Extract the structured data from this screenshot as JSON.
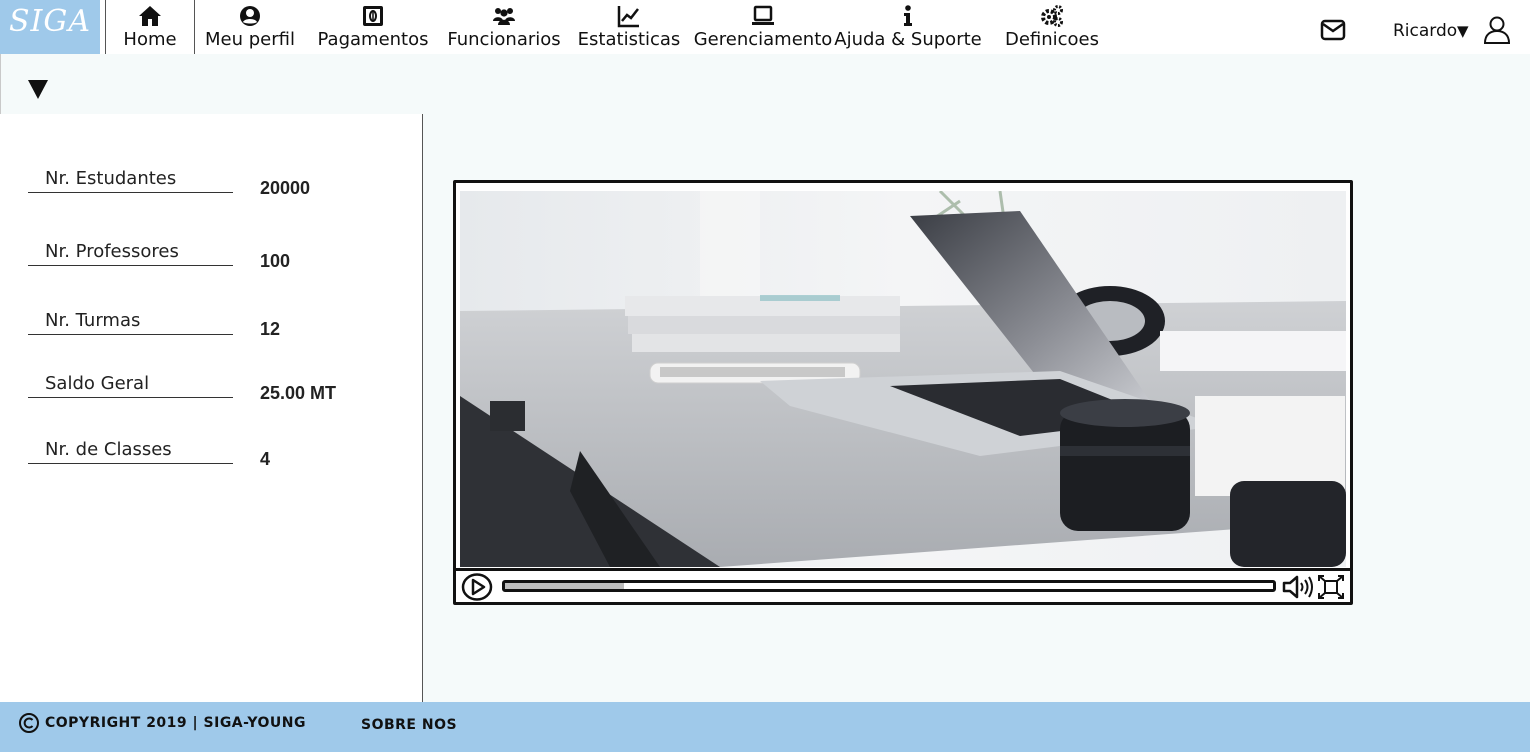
{
  "app": {
    "logo_text": "SIGA"
  },
  "nav": {
    "items": [
      {
        "label": "Home",
        "icon": "home-icon"
      },
      {
        "label": "Meu perfil",
        "icon": "user-circle-icon"
      },
      {
        "label": "Pagamentos",
        "icon": "money-bill-icon"
      },
      {
        "label": "Funcionarios",
        "icon": "users-icon"
      },
      {
        "label": "Estatisticas",
        "icon": "line-chart-icon"
      },
      {
        "label": "Gerenciamento",
        "icon": "laptop-icon"
      },
      {
        "label": "Ajuda & Suporte",
        "icon": "info-icon"
      },
      {
        "label": "Definicoes",
        "icon": "gears-icon"
      }
    ],
    "active": "Home"
  },
  "user": {
    "name": "Ricardo",
    "caret": "▼"
  },
  "stats": [
    {
      "label": "Nr. Estudantes",
      "value": "20000"
    },
    {
      "label": "Nr. Professores",
      "value": "100"
    },
    {
      "label": "Nr. Turmas",
      "value": "12"
    },
    {
      "label": "Saldo Geral",
      "value": "25.00 MT"
    },
    {
      "label": "Nr. de Classes",
      "value": "4"
    }
  ],
  "video": {
    "progress": 0.155
  },
  "footer": {
    "copyright": "COPYRIGHT 2019 | SIGA-YOUNG",
    "about": "SOBRE NOS"
  },
  "colors": {
    "accent": "#9fc9ea",
    "background": "#f5fafa"
  }
}
